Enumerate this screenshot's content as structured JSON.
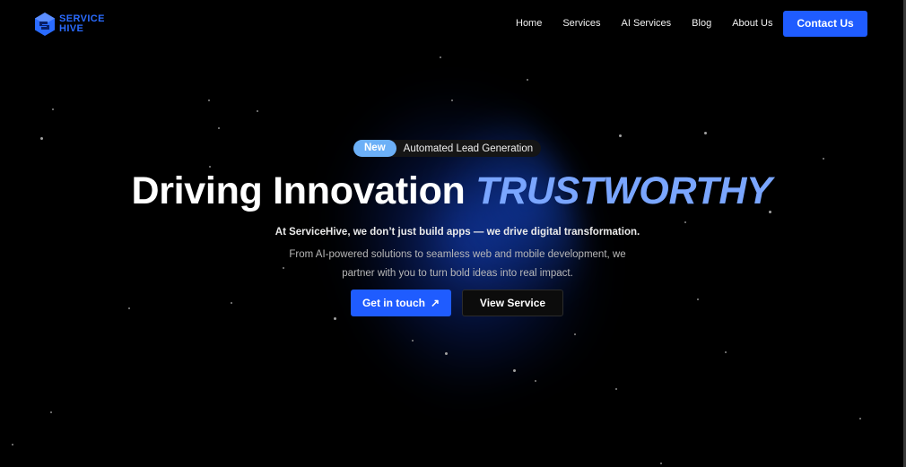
{
  "brand": {
    "line1": "SERVICE",
    "line2": "HIVE",
    "icon": "hive-logo-icon",
    "color": "#2a6bff"
  },
  "nav": {
    "items": [
      "Home",
      "Services",
      "AI Services",
      "Blog",
      "About Us"
    ],
    "cta": "Contact Us"
  },
  "hero": {
    "badge": "New",
    "badge_text": "Automated Lead Generation",
    "headline_main": "Driving Innovation",
    "headline_accent": "TRUSTWORTHY",
    "subtitle_bold": "At ServiceHive, we don’t just build apps — we drive digital transformation.",
    "subtitle_line1": "From AI-powered solutions to seamless web and mobile development, we",
    "subtitle_line2": "partner with you to turn bold ideas into real impact.",
    "primary_button": "Get in touch",
    "primary_button_icon": "arrow-up-right-icon",
    "secondary_button": "View Service"
  },
  "colors": {
    "accent": "#1f5cff",
    "headline_accent": "#7aa6ff",
    "badge": "#6cb0f7",
    "background": "#000000"
  }
}
